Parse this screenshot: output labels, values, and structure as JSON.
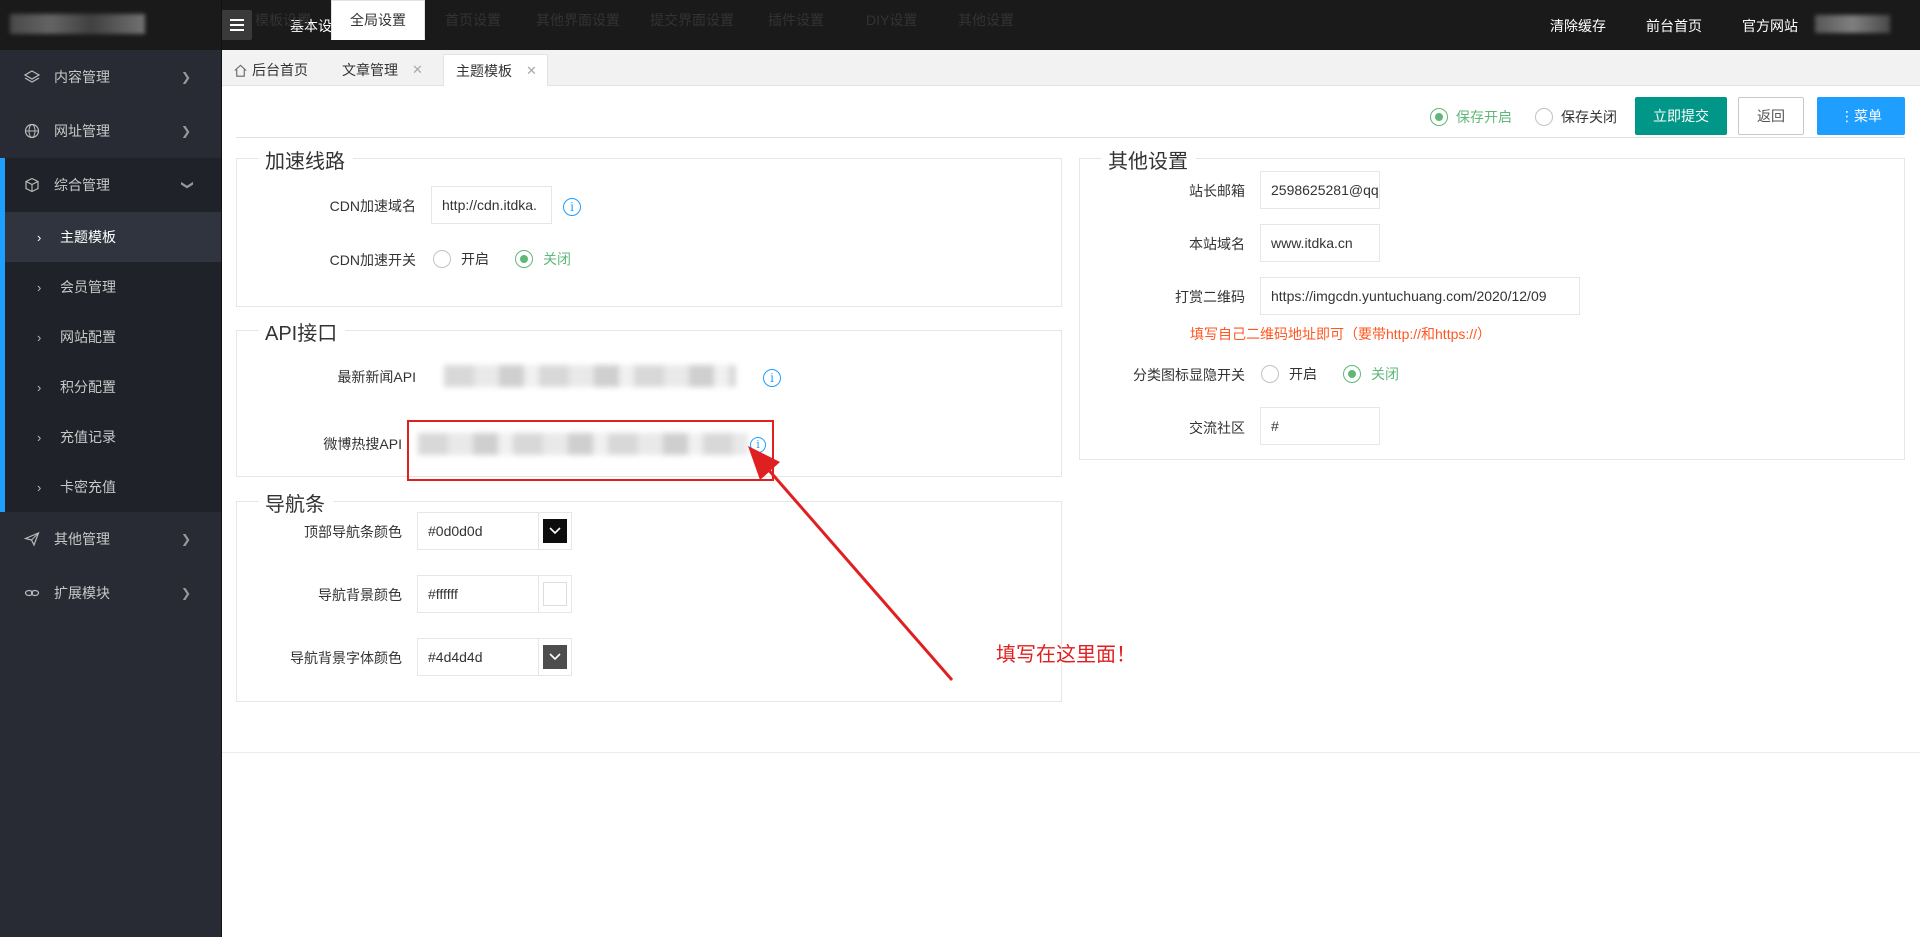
{
  "header": {
    "title": "基本设置",
    "links": [
      "清除缓存",
      "前台首页",
      "官方网站"
    ]
  },
  "sidebar": {
    "items": [
      {
        "label": "内容管理",
        "icon": "layers-icon"
      },
      {
        "label": "网址管理",
        "icon": "globe-icon"
      },
      {
        "label": "综合管理",
        "icon": "cube-icon",
        "expanded": true
      },
      {
        "label": "其他管理",
        "icon": "send-icon"
      },
      {
        "label": "扩展模块",
        "icon": "link-icon"
      }
    ],
    "subitems": [
      "主题模板",
      "会员管理",
      "网站配置",
      "积分配置",
      "充值记录",
      "卡密充值"
    ],
    "active_subitem": "主题模板"
  },
  "tabs": [
    {
      "label": "后台首页"
    },
    {
      "label": "文章管理"
    },
    {
      "label": "主题模板"
    }
  ],
  "subtabs": [
    "模板设置",
    "全局设置",
    "首页设置",
    "其他界面设置",
    "提交界面设置",
    "插件设置",
    "DIY设置",
    "其他设置"
  ],
  "active_subtab": "全局设置",
  "toolbar": {
    "save_on": "保存开启",
    "save_off": "保存关闭",
    "submit": "立即提交",
    "back": "返回",
    "menu": "⋮菜单"
  },
  "cdn": {
    "legend": "加速线路",
    "domain_label": "CDN加速域名",
    "domain_value": "http://cdn.itdka.",
    "switch_label": "CDN加速开关",
    "on": "开启",
    "off": "关闭"
  },
  "api": {
    "legend": "API接口",
    "news_label": "最新新闻API",
    "weibo_label": "微博热搜API"
  },
  "nav": {
    "legend": "导航条",
    "top_color_label": "顶部导航条颜色",
    "top_color_value": "#0d0d0d",
    "bg_color_label": "导航背景颜色",
    "bg_color_value": "#ffffff",
    "font_color_label": "导航背景字体颜色",
    "font_color_value": "#4d4d4d"
  },
  "other": {
    "legend": "其他设置",
    "email_label": "站长邮箱",
    "email_value": "2598625281@qq",
    "domain_label": "本站域名",
    "domain_value": "www.itdka.cn",
    "qr_label": "打赏二维码",
    "qr_value": "https://imgcdn.yuntuchuang.com/2020/12/09",
    "qr_hint": "填写自己二维码地址即可（要带http://和https://）",
    "icon_label": "分类图标显隐开关",
    "on": "开启",
    "off": "关闭",
    "community_label": "交流社区",
    "community_value": "#"
  },
  "annotation": {
    "text": "填写在这里面！"
  },
  "colors": {
    "accent_green": "#009688",
    "accent_blue": "#1e9fff",
    "radio_green": "#5fb878",
    "hint_red": "#ff5722",
    "annotation_red": "#e02020"
  }
}
